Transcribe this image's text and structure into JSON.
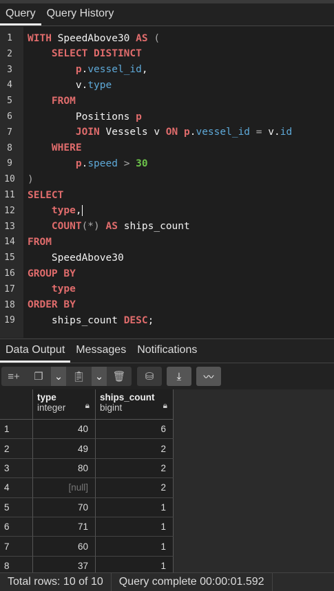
{
  "query_tabs": [
    {
      "label": "Query",
      "active": true
    },
    {
      "label": "Query History",
      "active": false
    }
  ],
  "code_lines": [
    [
      {
        "t": "WITH",
        "c": "kw"
      },
      {
        "t": " SpeedAbove30 ",
        "c": "id"
      },
      {
        "t": "AS",
        "c": "kw"
      },
      {
        "t": " (",
        "c": "op"
      }
    ],
    [
      {
        "t": "    "
      },
      {
        "t": "SELECT DISTINCT",
        "c": "kw"
      }
    ],
    [
      {
        "t": "        "
      },
      {
        "t": "p",
        "c": "alias"
      },
      {
        "t": ".",
        "c": "id"
      },
      {
        "t": "vessel_id",
        "c": "col"
      },
      {
        "t": ",",
        "c": "id"
      }
    ],
    [
      {
        "t": "        "
      },
      {
        "t": "v",
        "c": "id"
      },
      {
        "t": ".",
        "c": "id"
      },
      {
        "t": "type",
        "c": "col"
      }
    ],
    [
      {
        "t": "    "
      },
      {
        "t": "FROM",
        "c": "kw"
      }
    ],
    [
      {
        "t": "        "
      },
      {
        "t": "Positions ",
        "c": "id"
      },
      {
        "t": "p",
        "c": "alias"
      }
    ],
    [
      {
        "t": "        "
      },
      {
        "t": "JOIN",
        "c": "kw"
      },
      {
        "t": " Vessels v ",
        "c": "id"
      },
      {
        "t": "ON",
        "c": "kw"
      },
      {
        "t": " "
      },
      {
        "t": "p",
        "c": "alias"
      },
      {
        "t": ".",
        "c": "id"
      },
      {
        "t": "vessel_id",
        "c": "col"
      },
      {
        "t": " = ",
        "c": "op"
      },
      {
        "t": "v.",
        "c": "id"
      },
      {
        "t": "id",
        "c": "col"
      }
    ],
    [
      {
        "t": "    "
      },
      {
        "t": "WHERE",
        "c": "kw"
      }
    ],
    [
      {
        "t": "        "
      },
      {
        "t": "p",
        "c": "alias"
      },
      {
        "t": ".",
        "c": "id"
      },
      {
        "t": "speed",
        "c": "col"
      },
      {
        "t": " > ",
        "c": "op"
      },
      {
        "t": "30",
        "c": "num"
      }
    ],
    [
      {
        "t": ")",
        "c": "op"
      }
    ],
    [
      {
        "t": "SELECT",
        "c": "kw"
      }
    ],
    [
      {
        "t": "    "
      },
      {
        "t": "type",
        "c": "kw"
      },
      {
        "t": ",",
        "c": "id"
      },
      {
        "t": "",
        "c": "caret"
      }
    ],
    [
      {
        "t": "    "
      },
      {
        "t": "COUNT",
        "c": "kw"
      },
      {
        "t": "(*)",
        "c": "op"
      },
      {
        "t": " "
      },
      {
        "t": "AS",
        "c": "kw"
      },
      {
        "t": " ships_count",
        "c": "id"
      }
    ],
    [
      {
        "t": "FROM",
        "c": "kw"
      }
    ],
    [
      {
        "t": "    "
      },
      {
        "t": "SpeedAbove30",
        "c": "id"
      }
    ],
    [
      {
        "t": "GROUP BY",
        "c": "kw"
      }
    ],
    [
      {
        "t": "    "
      },
      {
        "t": "type",
        "c": "kw"
      }
    ],
    [
      {
        "t": "ORDER BY",
        "c": "kw"
      }
    ],
    [
      {
        "t": "    "
      },
      {
        "t": "ships_count ",
        "c": "id"
      },
      {
        "t": "DESC",
        "c": "kw"
      },
      {
        "t": ";",
        "c": "id"
      }
    ]
  ],
  "output_tabs": [
    {
      "label": "Data Output",
      "active": true
    },
    {
      "label": "Messages",
      "active": false
    },
    {
      "label": "Notifications",
      "active": false
    }
  ],
  "columns": [
    {
      "name": "type",
      "dtype": "integer"
    },
    {
      "name": "ships_count",
      "dtype": "bigint"
    }
  ],
  "rows": [
    {
      "n": "1",
      "type": "40",
      "count": "6"
    },
    {
      "n": "2",
      "type": "49",
      "count": "2"
    },
    {
      "n": "3",
      "type": "80",
      "count": "2"
    },
    {
      "n": "4",
      "type": "[null]",
      "count": "2"
    },
    {
      "n": "5",
      "type": "70",
      "count": "1"
    },
    {
      "n": "6",
      "type": "71",
      "count": "1"
    },
    {
      "n": "7",
      "type": "60",
      "count": "1"
    },
    {
      "n": "8",
      "type": "37",
      "count": "1"
    }
  ],
  "status": {
    "total_rows": "Total rows: 10 of 10",
    "query_time": "Query complete 00:00:01.592"
  }
}
